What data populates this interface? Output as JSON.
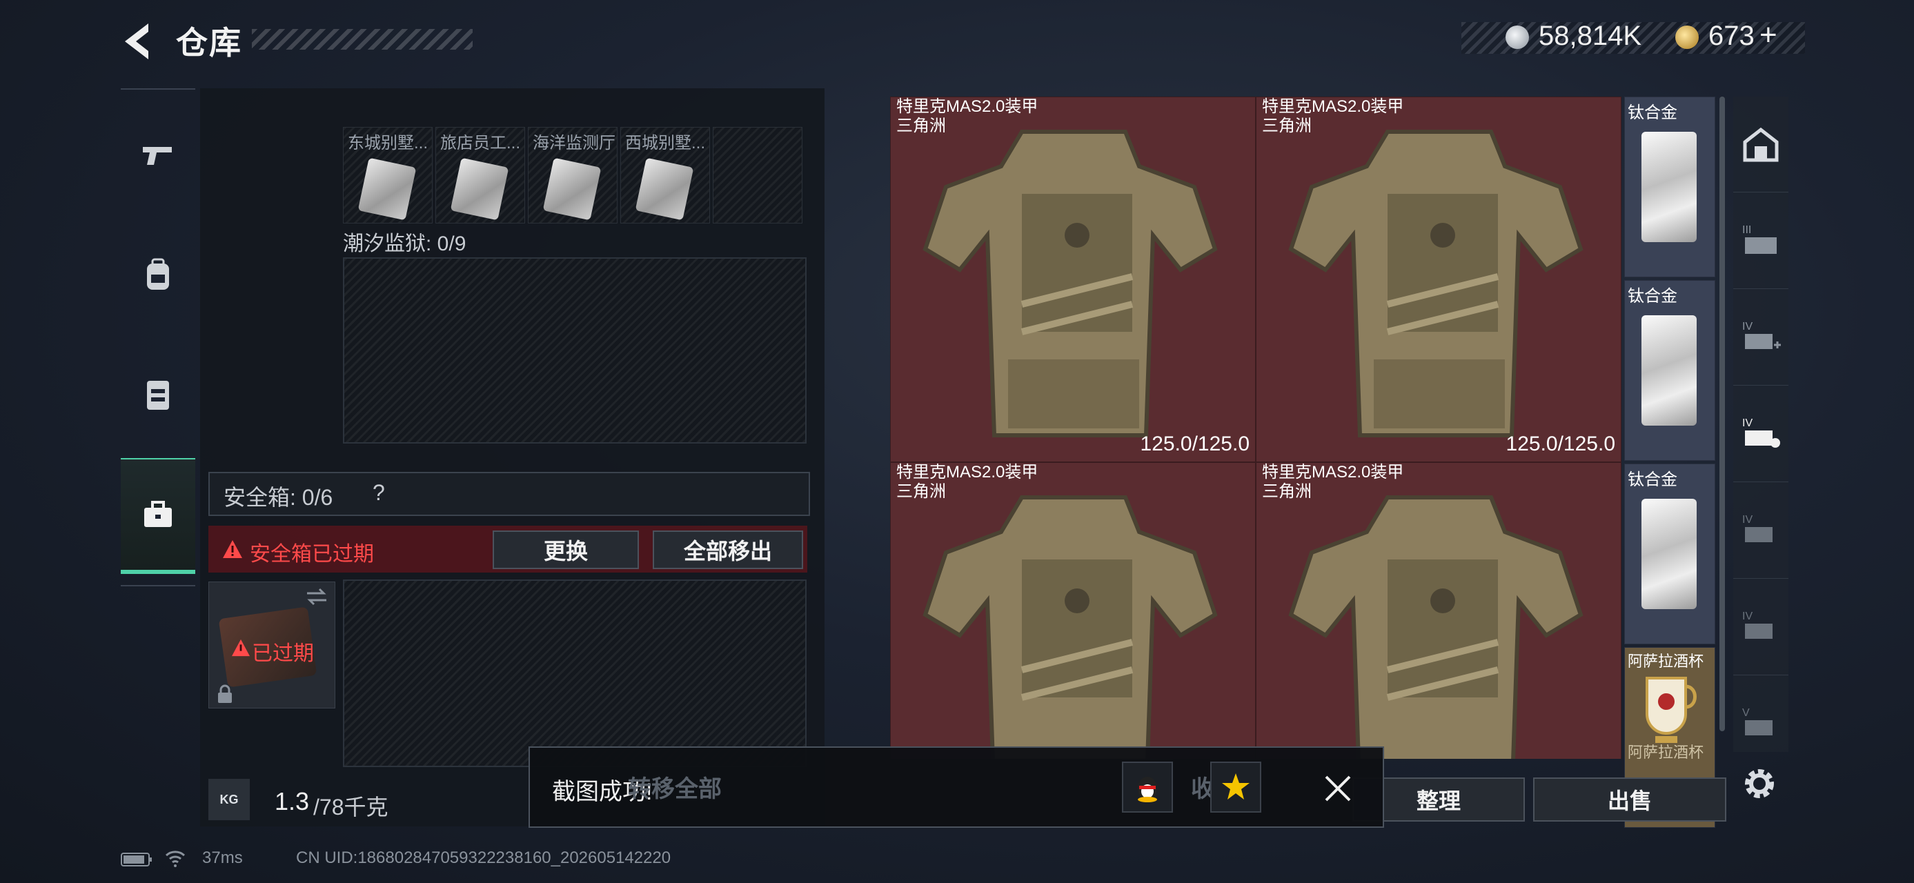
{
  "header": {
    "title": "仓库",
    "currency_silver": "58,814K",
    "currency_gold": "673",
    "gold_add": "+",
    "colors": {
      "silver": "#c9d0d8",
      "gold": "#d9b45a",
      "accent": "#4fd1a8",
      "alert": "#ff4a4a"
    }
  },
  "left_nav": {
    "items": [
      {
        "icon": "pistol-icon"
      },
      {
        "icon": "backpack-icon"
      },
      {
        "icon": "vest-icon"
      },
      {
        "icon": "briefcase-icon",
        "active": true
      }
    ]
  },
  "stash": {
    "mini_items": [
      {
        "label": "东城别墅..."
      },
      {
        "label": "旅店员工..."
      },
      {
        "label": "海洋监测厅"
      },
      {
        "label": "西城别墅..."
      }
    ],
    "prison_label": "潮汐监狱: 0/9",
    "safe_label": "安全箱: 0/6",
    "safe_help": "?",
    "expired_text": "安全箱已过期",
    "expired_badge": "已过期",
    "replace_btn": "更换",
    "move_all_out_btn": "全部移出",
    "weight_value": "1.3",
    "weight_max": "/78千克",
    "weight_icon_label": "KG"
  },
  "inventory": {
    "armor_items": [
      {
        "name": "特里克MAS2.0装甲",
        "sub": "三角洲",
        "durability": "125.0/125.0"
      },
      {
        "name": "特里克MAS2.0装甲",
        "sub": "三角洲",
        "durability": "125.0/125.0"
      },
      {
        "name": "特里克MAS2.0装甲",
        "sub": "三角洲",
        "durability": ""
      },
      {
        "name": "特里克MAS2.0装甲",
        "sub": "三角洲",
        "durability": ""
      }
    ],
    "side_items": [
      {
        "name": "钛合金"
      },
      {
        "name": "钛合金"
      },
      {
        "name": "钛合金"
      },
      {
        "name": "阿萨拉酒杯"
      }
    ],
    "side_extra": "阿萨拉酒杯"
  },
  "categories": [
    {
      "icon": "home-icon",
      "tier": ""
    },
    {
      "icon": "armor-tier-3-icon",
      "tier": "III"
    },
    {
      "icon": "armor-tier-4-plus-icon",
      "tier": "IV"
    },
    {
      "icon": "armor-tier-4-shield-icon",
      "tier": "IV"
    },
    {
      "icon": "armor-tier-4-b-icon",
      "tier": "IV"
    },
    {
      "icon": "armor-tier-4-c-icon",
      "tier": "IV"
    },
    {
      "icon": "armor-tier-5-icon",
      "tier": "V"
    }
  ],
  "bottom": {
    "transfer_all": "转移全部",
    "collect": "收藏",
    "organize": "整理",
    "sell": "出售"
  },
  "toast": {
    "text": "截图成功!"
  },
  "status": {
    "ping": "37ms",
    "uid": "CN UID:1868028470593222381­60_202605142220"
  }
}
